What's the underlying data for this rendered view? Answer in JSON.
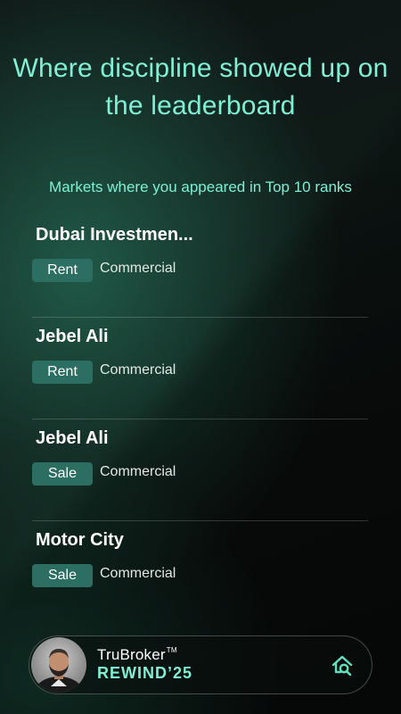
{
  "headline": "Where discipline showed up on the leaderboard",
  "subheading": "Markets where you appeared in Top 10 ranks",
  "markets": [
    {
      "name": "Dubai Investmen...",
      "type": "Rent",
      "category": "Commercial"
    },
    {
      "name": "Jebel Ali",
      "type": "Rent",
      "category": "Commercial"
    },
    {
      "name": "Jebel Ali",
      "type": "Sale",
      "category": "Commercial"
    },
    {
      "name": "Motor City",
      "type": "Sale",
      "category": "Commercial"
    }
  ],
  "footer": {
    "brand_name": "TruBroker",
    "trademark": "TM",
    "rewind": "REWIND’25",
    "icon": "home-search-icon"
  },
  "colors": {
    "accent": "#7ff0d3",
    "chip": "#2c6e62",
    "background": "#0b0f0e"
  }
}
